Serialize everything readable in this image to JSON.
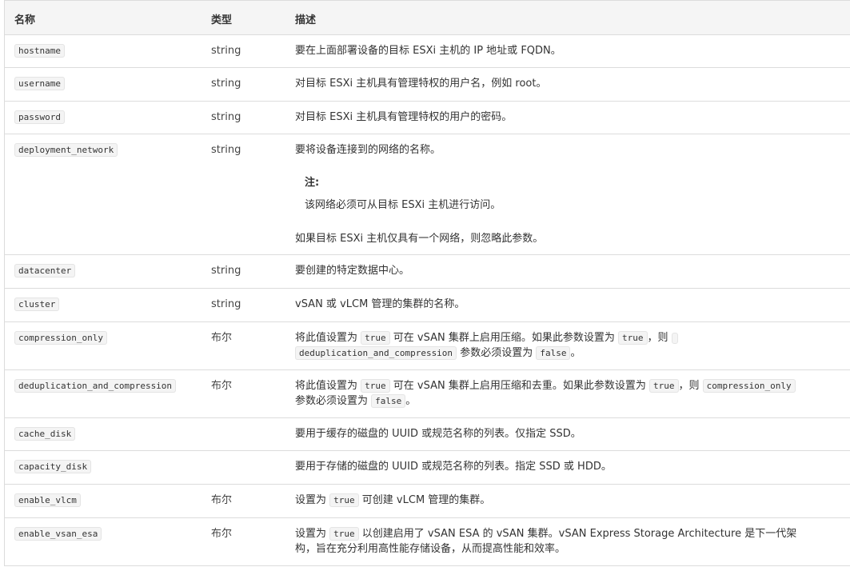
{
  "headers": {
    "name": "名称",
    "type": "类型",
    "desc": "描述"
  },
  "rows": [
    {
      "name": "hostname",
      "type": "string",
      "desc": "要在上面部署设备的目标 ESXi 主机的 IP 地址或 FQDN。"
    },
    {
      "name": "username",
      "type": "string",
      "desc": "对目标 ESXi 主机具有管理特权的用户名，例如 root。"
    },
    {
      "name": "password",
      "type": "string",
      "desc": "对目标 ESXi 主机具有管理特权的用户的密码。"
    },
    {
      "name": "deployment_network",
      "type": "string",
      "desc": "要将设备连接到的网络的名称。",
      "note_title": "注:",
      "note_text": "该网络必须可从目标 ESXi 主机进行访问。",
      "desc_extra": "如果目标 ESXi 主机仅具有一个网络，则忽略此参数。"
    },
    {
      "name": "datacenter",
      "type": "string",
      "desc": "要创建的特定数据中心。"
    },
    {
      "name": "cluster",
      "type": "string",
      "desc": "vSAN 或 vLCM 管理的集群的名称。"
    },
    {
      "name": "compression_only",
      "type": "布尔",
      "d1": "将此值设置为",
      "d_code1": "true",
      "d2": "可在 vSAN 集群上启用压缩。如果此参数设置为",
      "d_code2": "true",
      "d3": "，则",
      "d_code3": "deduplication_and_compression",
      "d4": "参数必须设置为",
      "d_code4": "false",
      "d5": "。"
    },
    {
      "name": "deduplication_and_compression",
      "type": "布尔",
      "d1": "将此值设置为",
      "d_code1": "true",
      "d2": "可在 vSAN 集群上启用压缩和去重。如果此参数设置为",
      "d_code2": "true",
      "d3": "，则",
      "d_code3": "compression_only",
      "d4": "参数必须设置为",
      "d_code4": "false",
      "d5": "。"
    },
    {
      "name": "cache_disk",
      "type": "",
      "desc": "要用于缓存的磁盘的 UUID 或规范名称的列表。仅指定 SSD。"
    },
    {
      "name": "capacity_disk",
      "type": "",
      "desc": "要用于存储的磁盘的 UUID 或规范名称的列表。指定 SSD 或 HDD。"
    },
    {
      "name": "enable_vlcm",
      "type": "布尔",
      "d1": "设置为",
      "d_code1": "true",
      "d2": "可创建 vLCM 管理的集群。"
    },
    {
      "name": "enable_vsan_esa",
      "type": "布尔",
      "d1": "设置为",
      "d_code1": "true",
      "d2": "以创建启用了 vSAN ESA 的 vSAN 集群。vSAN Express Storage Architecture 是下一代架",
      "d3": "构，旨在充分利用高性能存储设备，从而提高性能和效率。"
    }
  ]
}
